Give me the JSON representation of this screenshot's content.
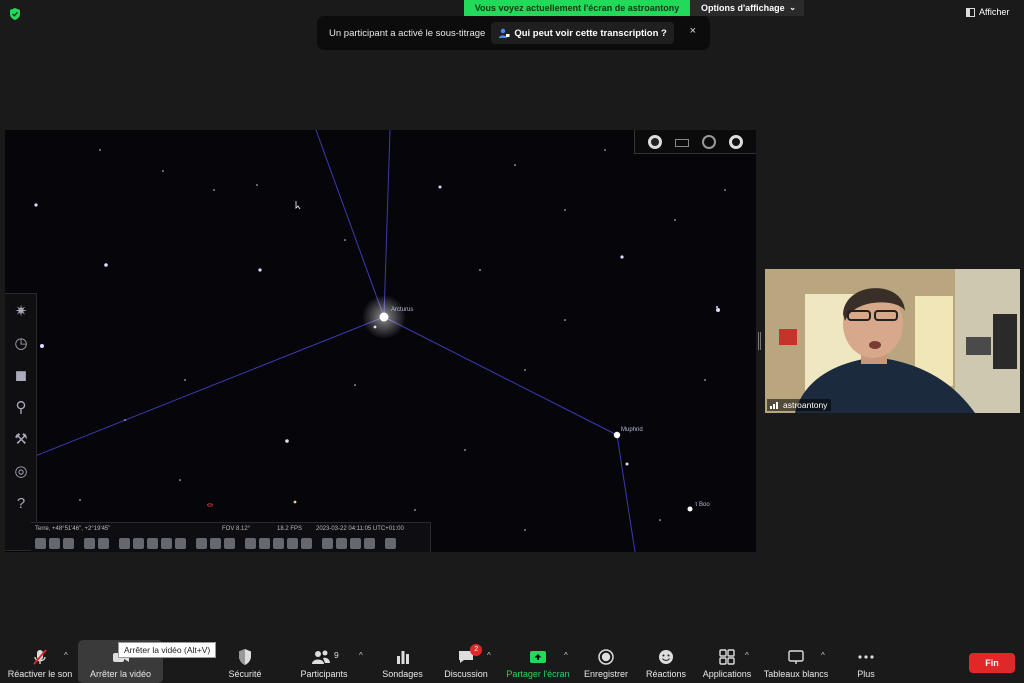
{
  "top": {
    "sharing_banner": "Vous voyez actuellement l'écran de astroantony",
    "view_options": "Options d'affichage",
    "afficher": "Afficher"
  },
  "caption_toast": {
    "message": "Un participant a activé le sous-titrage",
    "who_button": "Qui peut voir cette transcription ?",
    "close": "×"
  },
  "stellarium": {
    "stars": {
      "arcturus": "Arcturus",
      "muphrid": "Muphrid",
      "tau_boo": "τ Boo"
    },
    "status": {
      "location": "Terre, +48°51'46\", +2°19'45\"",
      "fov": "FOV 8.12°",
      "fps": "18.2 FPS",
      "datetime": "2023-03-22  04:11:05 UTC+01:00"
    },
    "left_toolbar": [
      "sky-settings-icon",
      "clock-icon",
      "sky-culture-icon",
      "search-icon",
      "tools-icon",
      "compass-icon",
      "help-icon"
    ],
    "left_toolbar_glyphs": [
      "✷",
      "◷",
      "◼",
      "⚲",
      "⚒",
      "◎",
      "?"
    ]
  },
  "video": {
    "participant_name": "astroantony"
  },
  "toolbar": {
    "unmute": "Réactiver le son",
    "stop_video": "Arrêter la vidéo",
    "tooltip": "Arrêter la vidéo (Alt+V)",
    "security": "Sécurité",
    "participants": "Participants",
    "participants_count": "9",
    "polls": "Sondages",
    "chat": "Discussion",
    "chat_badge": "2",
    "share_screen": "Partager l'écran",
    "record": "Enregistrer",
    "reactions": "Réactions",
    "apps": "Applications",
    "whiteboards": "Tableaux blancs",
    "more": "Plus",
    "end": "Fin"
  },
  "colors": {
    "zoom_green": "#23d959",
    "end_red": "#e02828",
    "constellation_line": "#3b3bb0"
  }
}
